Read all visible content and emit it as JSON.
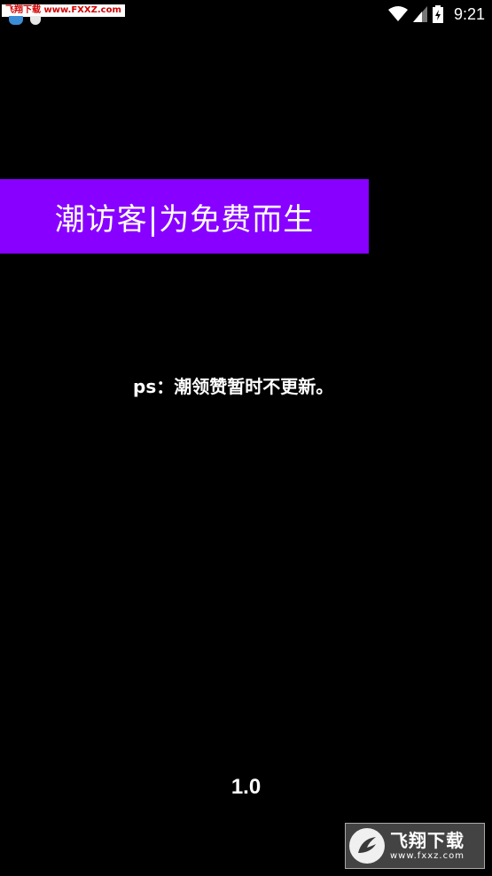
{
  "status_bar": {
    "watermark": "飞翔下载 www.FXXZ.com",
    "time": "9:21",
    "icons": [
      "notification-app-icon",
      "notification-image-icon",
      "wifi-icon",
      "cell-signal-icon",
      "battery-icon"
    ]
  },
  "banner": {
    "title": "潮访客|为免费而生",
    "color": "#8800ff"
  },
  "notice": "ps：潮领赞暂时不更新。",
  "version": "1.0",
  "watermark_logo": {
    "main": "飞翔下载",
    "sub": "www.fxxz.com"
  }
}
